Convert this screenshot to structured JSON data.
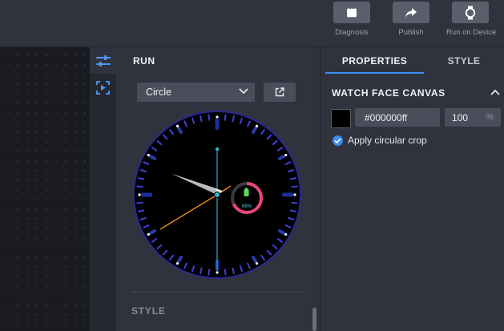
{
  "toolbar": {
    "diagnosis_label": "Diagnosis",
    "publish_label": "Publish",
    "run_on_device_label": "Run on Device"
  },
  "run_panel": {
    "title": "RUN",
    "shape_select": "Circle",
    "style_section": "STYLE",
    "watch_preview": {
      "battery_percent_text": "68%",
      "battery_level": 0.68
    }
  },
  "properties_panel": {
    "tabs": [
      "PROPERTIES",
      "STYLE"
    ],
    "active_tab": "PROPERTIES",
    "section_title": "WATCH FACE CANVAS",
    "color_value": "#000000ff",
    "opacity_value": "100",
    "opacity_unit": "%",
    "circular_crop_label": "Apply circular crop",
    "circular_crop_checked": true
  },
  "colors": {
    "accent": "#3d8bf2",
    "tick_color": "#4a3cd8",
    "battery_ring": "#e8457c",
    "second_hand": "#f08a1c",
    "center_hand": "#29b6c9"
  }
}
